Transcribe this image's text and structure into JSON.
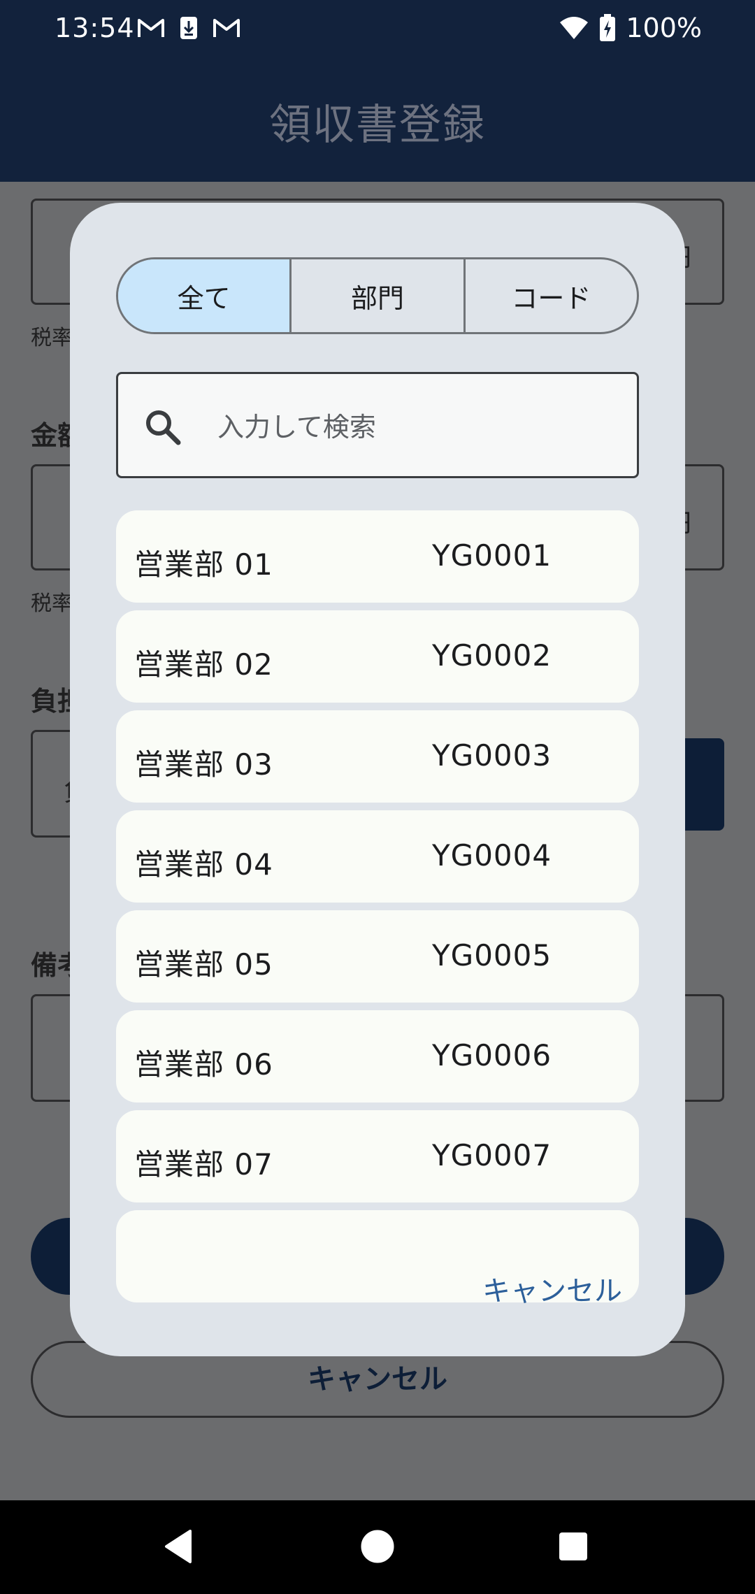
{
  "status_bar": {
    "time": "13:54",
    "battery_text": "100%",
    "icons_left": [
      "gmail-icon",
      "download-icon",
      "gmail-icon"
    ],
    "icons_right": [
      "wifi-icon",
      "battery-charging-icon"
    ]
  },
  "app_bar": {
    "title": "領収書登録"
  },
  "background_form": {
    "tax_note_1": "税率",
    "amount_label": "金額",
    "tax_note_2": "税率",
    "burden_label": "負担",
    "burden_field_text": "負",
    "memo_label": "備考",
    "yen_1": "円",
    "yen_2": "円",
    "cancel_label": "キャンセル"
  },
  "dialog": {
    "tabs": [
      {
        "label": "全て",
        "selected": true
      },
      {
        "label": "部門",
        "selected": false
      },
      {
        "label": "コード",
        "selected": false
      }
    ],
    "search": {
      "placeholder": "入力して検索",
      "value": ""
    },
    "items": [
      {
        "name": "営業部 01",
        "code": "YG0001"
      },
      {
        "name": "営業部 02",
        "code": "YG0002"
      },
      {
        "name": "営業部 03",
        "code": "YG0003"
      },
      {
        "name": "営業部 04",
        "code": "YG0004"
      },
      {
        "name": "営業部 05",
        "code": "YG0005"
      },
      {
        "name": "営業部 06",
        "code": "YG0006"
      },
      {
        "name": "営業部 07",
        "code": "YG0007"
      }
    ],
    "cancel_label": "キャンセル"
  },
  "colors": {
    "app_bar": "#12223c",
    "selected_tab": "#c9e6fb",
    "dialog_bg": "#dfe4ea",
    "accent_text": "#2c5f9a"
  }
}
